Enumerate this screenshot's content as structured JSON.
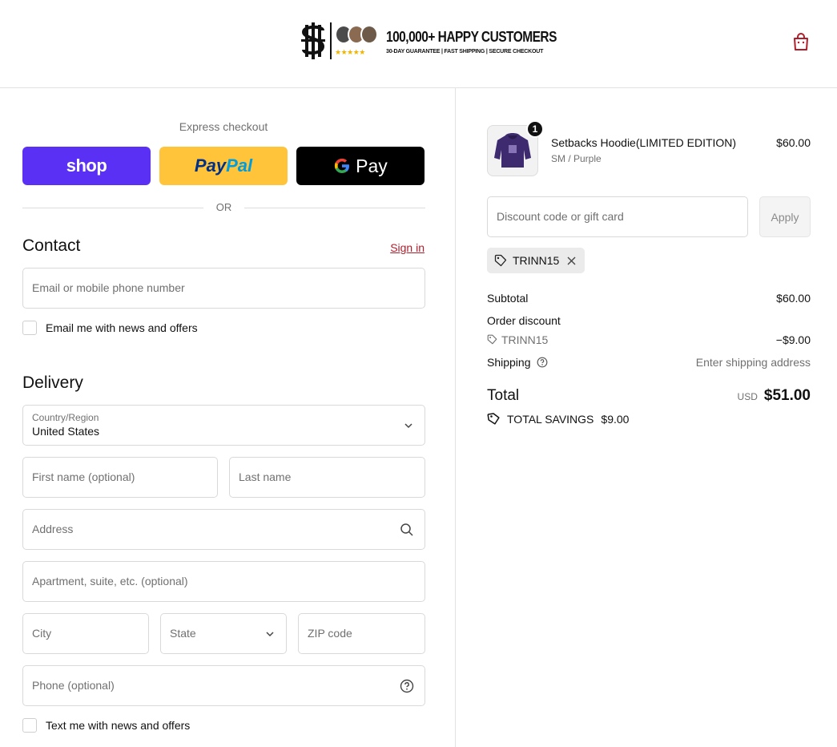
{
  "header": {
    "headline": "100,000+ HAPPY CUSTOMERS",
    "subline": "30-DAY GUARANTEE  |  FAST SHIPPING  |  SECURE CHECKOUT",
    "stars": "★★★★★",
    "cart_icon": "shopping-bag-icon"
  },
  "express": {
    "label": "Express checkout",
    "shop_label": "shop",
    "paypal_part1": "Pay",
    "paypal_part2": "Pal",
    "gpay_label": "Pay",
    "or_label": "OR"
  },
  "contact": {
    "title": "Contact",
    "sign_in": "Sign in",
    "email_placeholder": "Email or mobile phone number",
    "news_checkbox": "Email me with news and offers"
  },
  "delivery": {
    "title": "Delivery",
    "country_label": "Country/Region",
    "country_value": "United States",
    "first_name": "First name (optional)",
    "last_name": "Last name",
    "address": "Address",
    "apartment": "Apartment, suite, etc. (optional)",
    "city": "City",
    "state": "State",
    "zip": "ZIP code",
    "phone": "Phone (optional)",
    "text_checkbox": "Text me with news and offers"
  },
  "order": {
    "quantity": "1",
    "product_name": "Setbacks Hoodie(LIMITED EDITION)",
    "variant": "SM / Purple",
    "price": "$60.00",
    "discount_placeholder": "Discount code or gift card",
    "apply_label": "Apply",
    "applied_code": "TRINN15",
    "subtotal_label": "Subtotal",
    "subtotal_value": "$60.00",
    "order_discount_label": "Order discount",
    "discount_code": "TRINN15",
    "discount_value": "−$9.00",
    "shipping_label": "Shipping",
    "shipping_value": "Enter shipping address",
    "total_label": "Total",
    "currency": "USD",
    "total_value": "$51.00",
    "savings_label": "TOTAL SAVINGS",
    "savings_value": "$9.00"
  },
  "colors": {
    "shop_purple": "#5a31f4",
    "paypal_yellow": "#ffc439",
    "link_red": "#b01e2c"
  }
}
